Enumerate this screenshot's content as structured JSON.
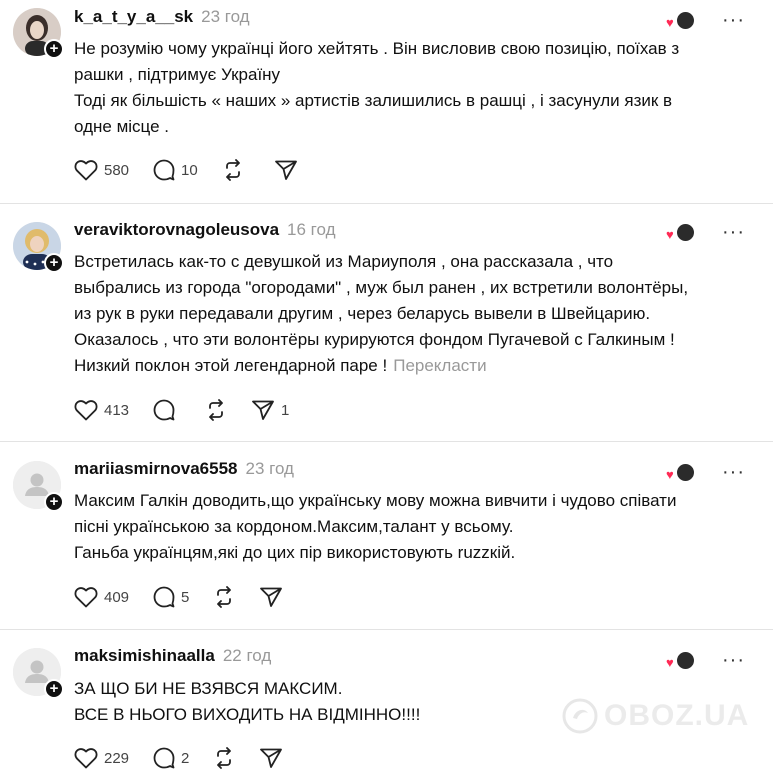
{
  "posts": [
    {
      "username": "k_a_t_y_a__sk",
      "time": "23 год",
      "lines": [
        "Не розумію чому українці його хейтять . Він висловив свою позицію, поїхав з",
        "рашки , підтримує Україну",
        "Тоді як більшість « наших » артистів залишились в рашці , і засунули язик в",
        "одне місце ."
      ],
      "translate": "",
      "likes": "580",
      "replies": "10",
      "shares": ""
    },
    {
      "username": "veraviktorovnagoleusova",
      "time": "16 год",
      "lines": [
        "Встретилась как-то с девушкой из Мариуполя , она рассказала , что",
        "выбрались из города \"огородами\" , муж был ранен , их встретили волонтёры,",
        "из рук в руки передавали другим , через беларусь вывели в Швейцарию.",
        "Оказалось , что эти волонтёры курируются фондом Пугачевой с Галкиным !",
        "Низкий поклон этой легендарной паре !"
      ],
      "translate": "Перекласти",
      "likes": "413",
      "replies": "",
      "shares": "1"
    },
    {
      "username": "mariiasmirnova6558",
      "time": "23 год",
      "lines": [
        "Максим Галкін доводить,що українську мову можна вивчити і чудово співати",
        "пісні українською за кордоном.Максим,талант у всьому.",
        "Ганьба українцям,які до цих пір використовують ruzzкій."
      ],
      "translate": "",
      "likes": "409",
      "replies": "5",
      "shares": ""
    },
    {
      "username": "maksimishinaalla",
      "time": "22 год",
      "lines": [
        "ЗА ЩО БИ НЕ ВЗЯВСЯ МАКСИМ.",
        "ВСЕ В НЬОГО ВИХОДИТЬ НА ВІДМІННО!!!!"
      ],
      "translate": "",
      "likes": "229",
      "replies": "2",
      "shares": ""
    }
  ],
  "icons": {
    "like": "heart-outline-icon",
    "reply": "speech-bubble-icon",
    "repost": "repost-arrows-icon",
    "share": "send-paper-plane-icon",
    "more": "more-dots-icon",
    "follow": "plus-icon"
  },
  "watermark": "OBOZ.UA",
  "colors": {
    "text": "#101010",
    "muted": "#999999",
    "heart": "#ff2a55",
    "divider": "#e3e3e3"
  }
}
